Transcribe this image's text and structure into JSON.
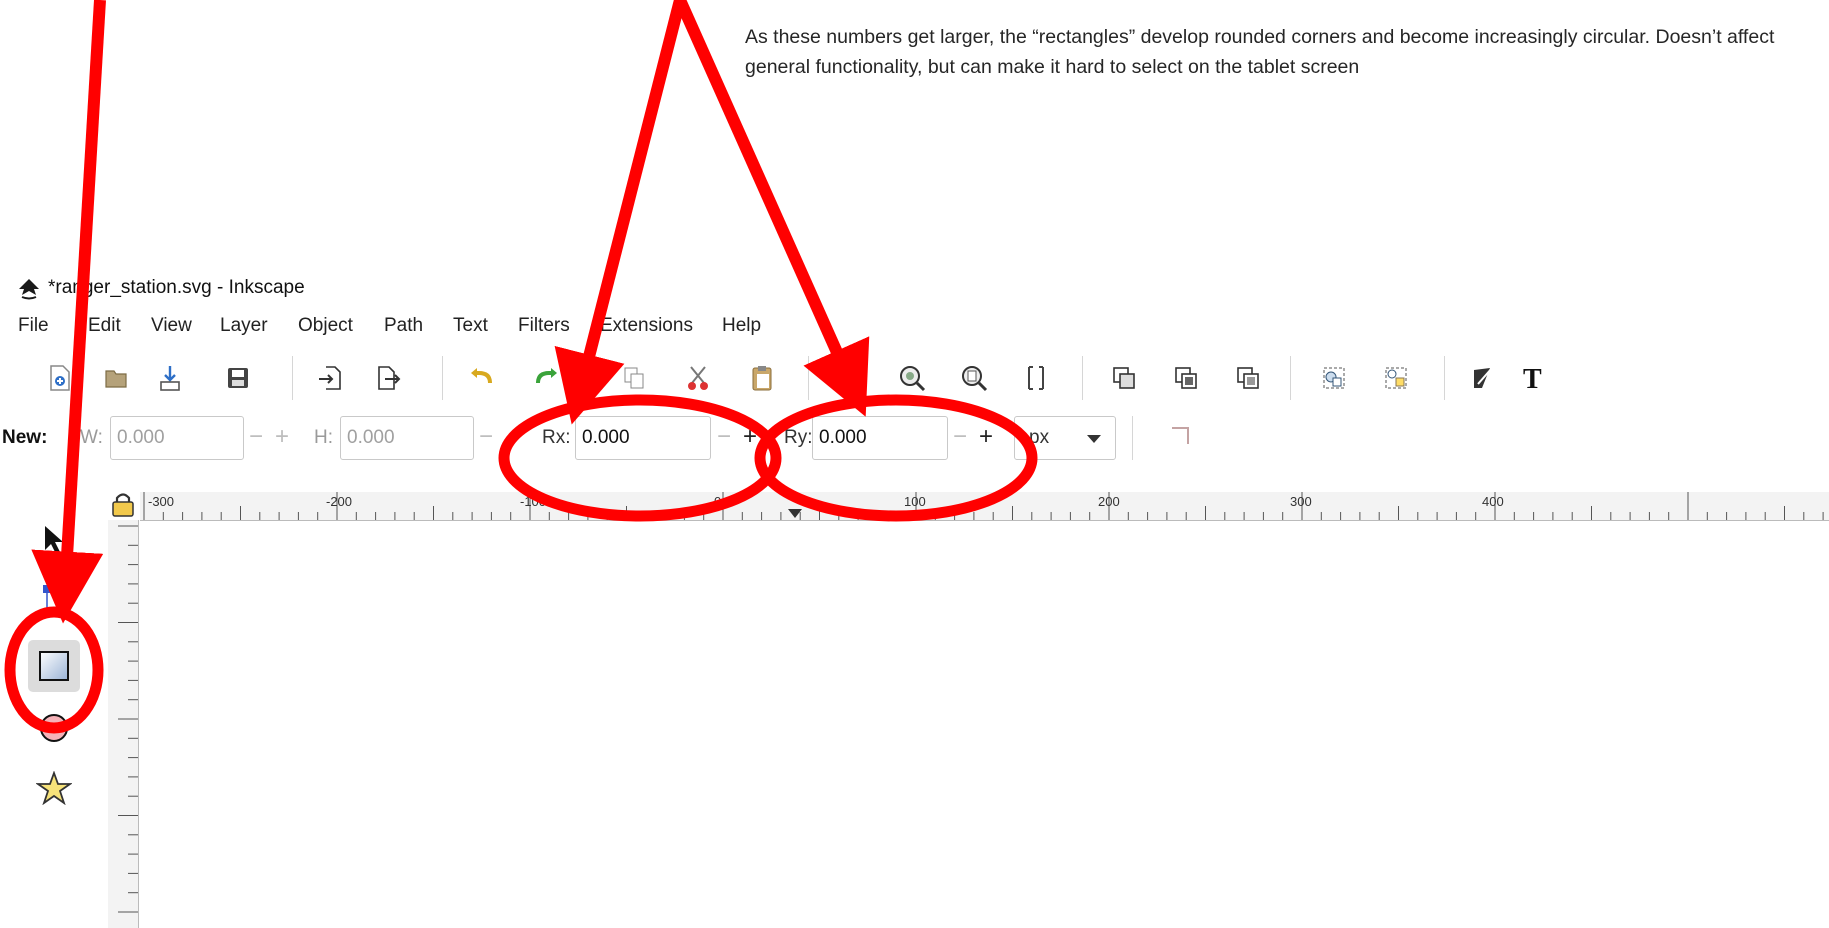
{
  "annotation": {
    "text": "As these numbers get larger, the “rectangles” develop rounded corners and become increasingly circular. Doesn’t affect general functionality, but can make it hard to select on the tablet screen"
  },
  "window": {
    "title": "*ranger_station.svg - Inkscape"
  },
  "menu": {
    "items": [
      "File",
      "Edit",
      "View",
      "Layer",
      "Object",
      "Path",
      "Text",
      "Filters",
      "Extensions",
      "Help"
    ]
  },
  "tool_controls": {
    "heading": "New:",
    "width_label": "W:",
    "width_value": "0.000",
    "height_label": "H:",
    "height_value": "0.000",
    "rx_label": "Rx:",
    "rx_value": "0.000",
    "ry_label": "Ry:",
    "ry_value": "0.000",
    "unit": "px",
    "minus": "−",
    "plus": "+"
  },
  "ruler": {
    "labels": [
      "-300",
      "-200",
      "-100",
      "0",
      "100",
      "200",
      "300",
      "400"
    ]
  },
  "colors": {
    "highlight_red": "#ff0000",
    "toolbar_bg": "#ffffff",
    "ruler_bg": "#f3f3f3",
    "active_tool_bg": "#dcdcdc"
  },
  "icons": {
    "commands": [
      "new-document-icon",
      "open-icon",
      "save-as-icon",
      "print-icon",
      "import-icon",
      "export-icon",
      "undo-icon",
      "redo-icon",
      "copy-icon",
      "cut-icon",
      "paste-icon",
      "zoom-selection-icon",
      "zoom-drawing-icon",
      "zoom-page-icon",
      "zoom-page-width-icon",
      "duplicate-icon",
      "clone-icon",
      "unlink-clone-icon",
      "group-icon",
      "ungroup-icon",
      "fill-stroke-icon",
      "text-font-icon"
    ],
    "tools": [
      "selector-tool-icon",
      "node-tool-icon",
      "rectangle-tool-icon",
      "ellipse-tool-icon",
      "star-tool-icon"
    ]
  },
  "active_tool": "rectangle-tool-icon"
}
